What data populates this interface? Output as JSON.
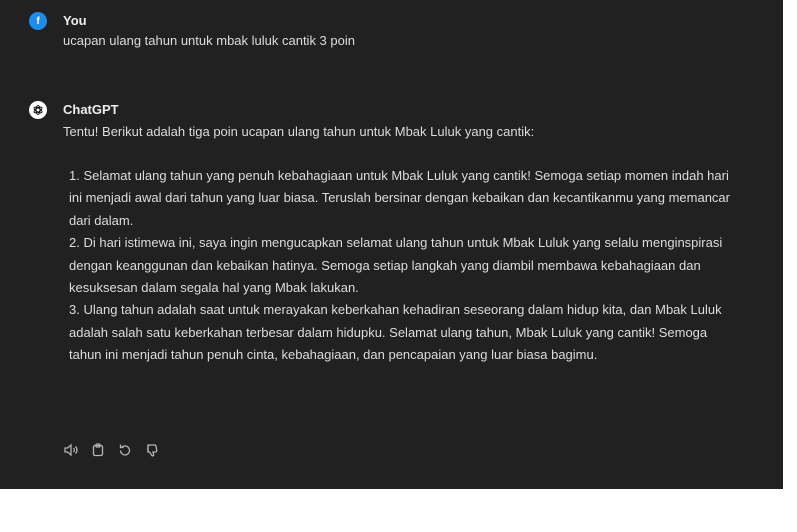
{
  "user": {
    "avatar_letter": "f",
    "name": "You",
    "message": "ucapan ulang tahun untuk mbak luluk cantik 3 poin"
  },
  "assistant": {
    "name": "ChatGPT",
    "intro": "Tentu! Berikut adalah tiga poin ucapan ulang tahun untuk Mbak Luluk yang cantik:",
    "points": [
      "1. Selamat ulang tahun yang penuh kebahagiaan untuk Mbak Luluk yang cantik! Semoga setiap momen indah hari ini menjadi awal dari tahun yang luar biasa. Teruslah bersinar dengan kebaikan dan kecantikanmu yang memancar dari dalam.",
      "2. Di hari istimewa ini, saya ingin mengucapkan selamat ulang tahun untuk Mbak Luluk yang selalu menginspirasi dengan keanggunan dan kebaikan hatinya. Semoga setiap langkah yang diambil membawa kebahagiaan dan kesuksesan dalam segala hal yang Mbak lakukan.",
      "3. Ulang tahun adalah saat untuk merayakan keberkahan kehadiran seseorang dalam hidup kita, dan Mbak Luluk adalah salah satu keberkahan terbesar dalam hidupku. Selamat ulang tahun, Mbak Luluk yang cantik! Semoga tahun ini menjadi tahun penuh cinta, kebahagiaan, dan pencapaian yang luar biasa bagimu."
    ]
  },
  "actions": [
    {
      "icon": "speaker-icon"
    },
    {
      "icon": "copy-icon"
    },
    {
      "icon": "regenerate-icon"
    },
    {
      "icon": "thumbs-down-icon"
    }
  ],
  "colors": {
    "background": "#212121",
    "user_avatar": "#1f8bea",
    "text": "#dcdcdc"
  }
}
